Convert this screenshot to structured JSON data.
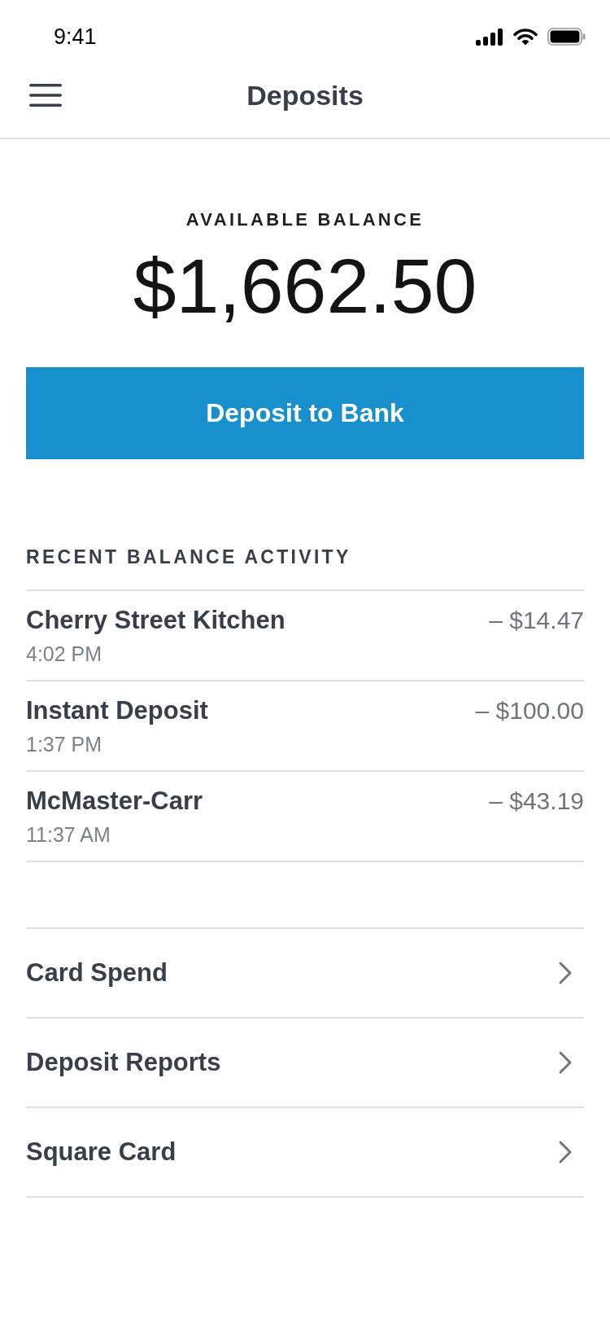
{
  "status_bar": {
    "time": "9:41"
  },
  "header": {
    "title": "Deposits"
  },
  "balance": {
    "label": "AVAILABLE BALANCE",
    "amount": "$1,662.50"
  },
  "deposit_button": {
    "label": "Deposit to Bank"
  },
  "activity": {
    "heading": "RECENT BALANCE ACTIVITY",
    "rows": [
      {
        "name": "Cherry Street Kitchen",
        "time": "4:02 PM",
        "amount": "– $14.47"
      },
      {
        "name": "Instant Deposit",
        "time": "1:37 PM",
        "amount": "– $100.00"
      },
      {
        "name": "McMaster-Carr",
        "time": "11:37 AM",
        "amount": "– $43.19"
      }
    ]
  },
  "links": [
    {
      "label": "Card Spend"
    },
    {
      "label": "Deposit Reports"
    },
    {
      "label": "Square Card"
    }
  ]
}
